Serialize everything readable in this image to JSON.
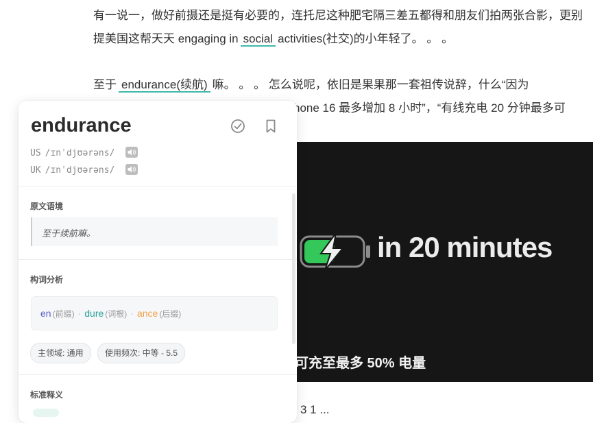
{
  "article": {
    "line1": "有一说一，做好前摄还是挺有必要的，连托尼这种肥宅隔三差五都得和朋友们拍两张合影，更别",
    "line2_pre": "提美国这帮天天 engaging in",
    "line2_hl": "social",
    "line2_post": "activities(社交)的小年轻了。 。 。",
    "line3_pre": "至于",
    "line3_hl": "endurance(续航)",
    "line3_post": "嘛。 。 。 怎么说呢，依旧是果果那一套祖传说辞，什么“因为",
    "line4_frag": "hone 16 最多增加 8 小时”，“有线充电 20 分钟最多可",
    "bottom_frag": "3 1 ..."
  },
  "video": {
    "title": "in 20 minutes",
    "caption": "可充至最多 50% 电量"
  },
  "popup": {
    "word": "endurance",
    "us_label": "US",
    "us_ipa": "/ɪnˈdjʊərəns/",
    "uk_label": "UK",
    "uk_ipa": "/ɪnˈdjʊərəns/",
    "context_title": "原文语境",
    "context_text": "至于续航嘛。",
    "morph_title": "构词分析",
    "prefix": "en",
    "prefix_tag": "(前缀)",
    "root": "dure",
    "root_tag": "(词根)",
    "suffix": "ance",
    "suffix_tag": "(后缀)",
    "tag_domain": "主领域: 通用",
    "tag_freq": "使用频次: 中等 - 5.5",
    "def_title": "标准释义"
  },
  "icons": {
    "mastered": "check-circle-icon",
    "bookmark": "bookmark-icon",
    "speaker": "speaker-icon",
    "battery": "battery-charging-icon"
  },
  "colors": {
    "accent": "#3fb8a8",
    "prefix": "#5b5fc7",
    "root": "#2aa198",
    "suffix": "#f2a14a",
    "battery_green": "#34c759"
  }
}
